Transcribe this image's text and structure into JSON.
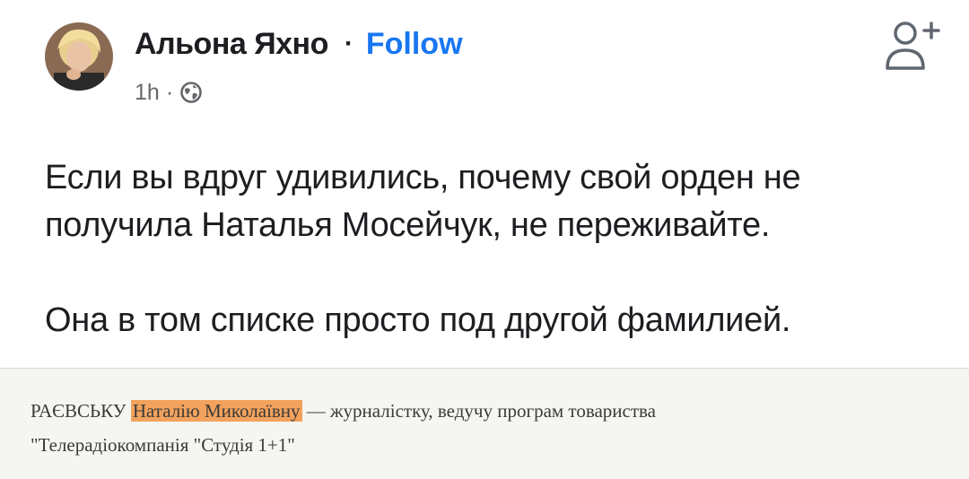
{
  "post": {
    "author": {
      "name": "Альона Яхно",
      "avatar_icon": "profile-photo"
    },
    "separator": "·",
    "follow_label": "Follow",
    "meta": {
      "time": "1h",
      "separator": "·",
      "audience_icon": "globe-icon"
    },
    "add_friend_icon": "add-friend-icon",
    "paragraphs": [
      "Если вы вдруг удивились, почему свой орден не получила Наталья Мосейчук, не переживайте.",
      "Она в том списке просто под другой фамилией."
    ]
  },
  "document_excerpt": {
    "line1_before": "РАЄВСЬКУ ",
    "line1_highlight": "Наталію Миколаївну",
    "line1_after": " — журналістку, ведучу програм товариства",
    "line2": "\"Телерадіокомпанія \"Студія 1+1\""
  },
  "colors": {
    "link": "#1877f2",
    "meta": "#65676b",
    "text": "#1c1e21",
    "highlight": "#f2a25c"
  }
}
